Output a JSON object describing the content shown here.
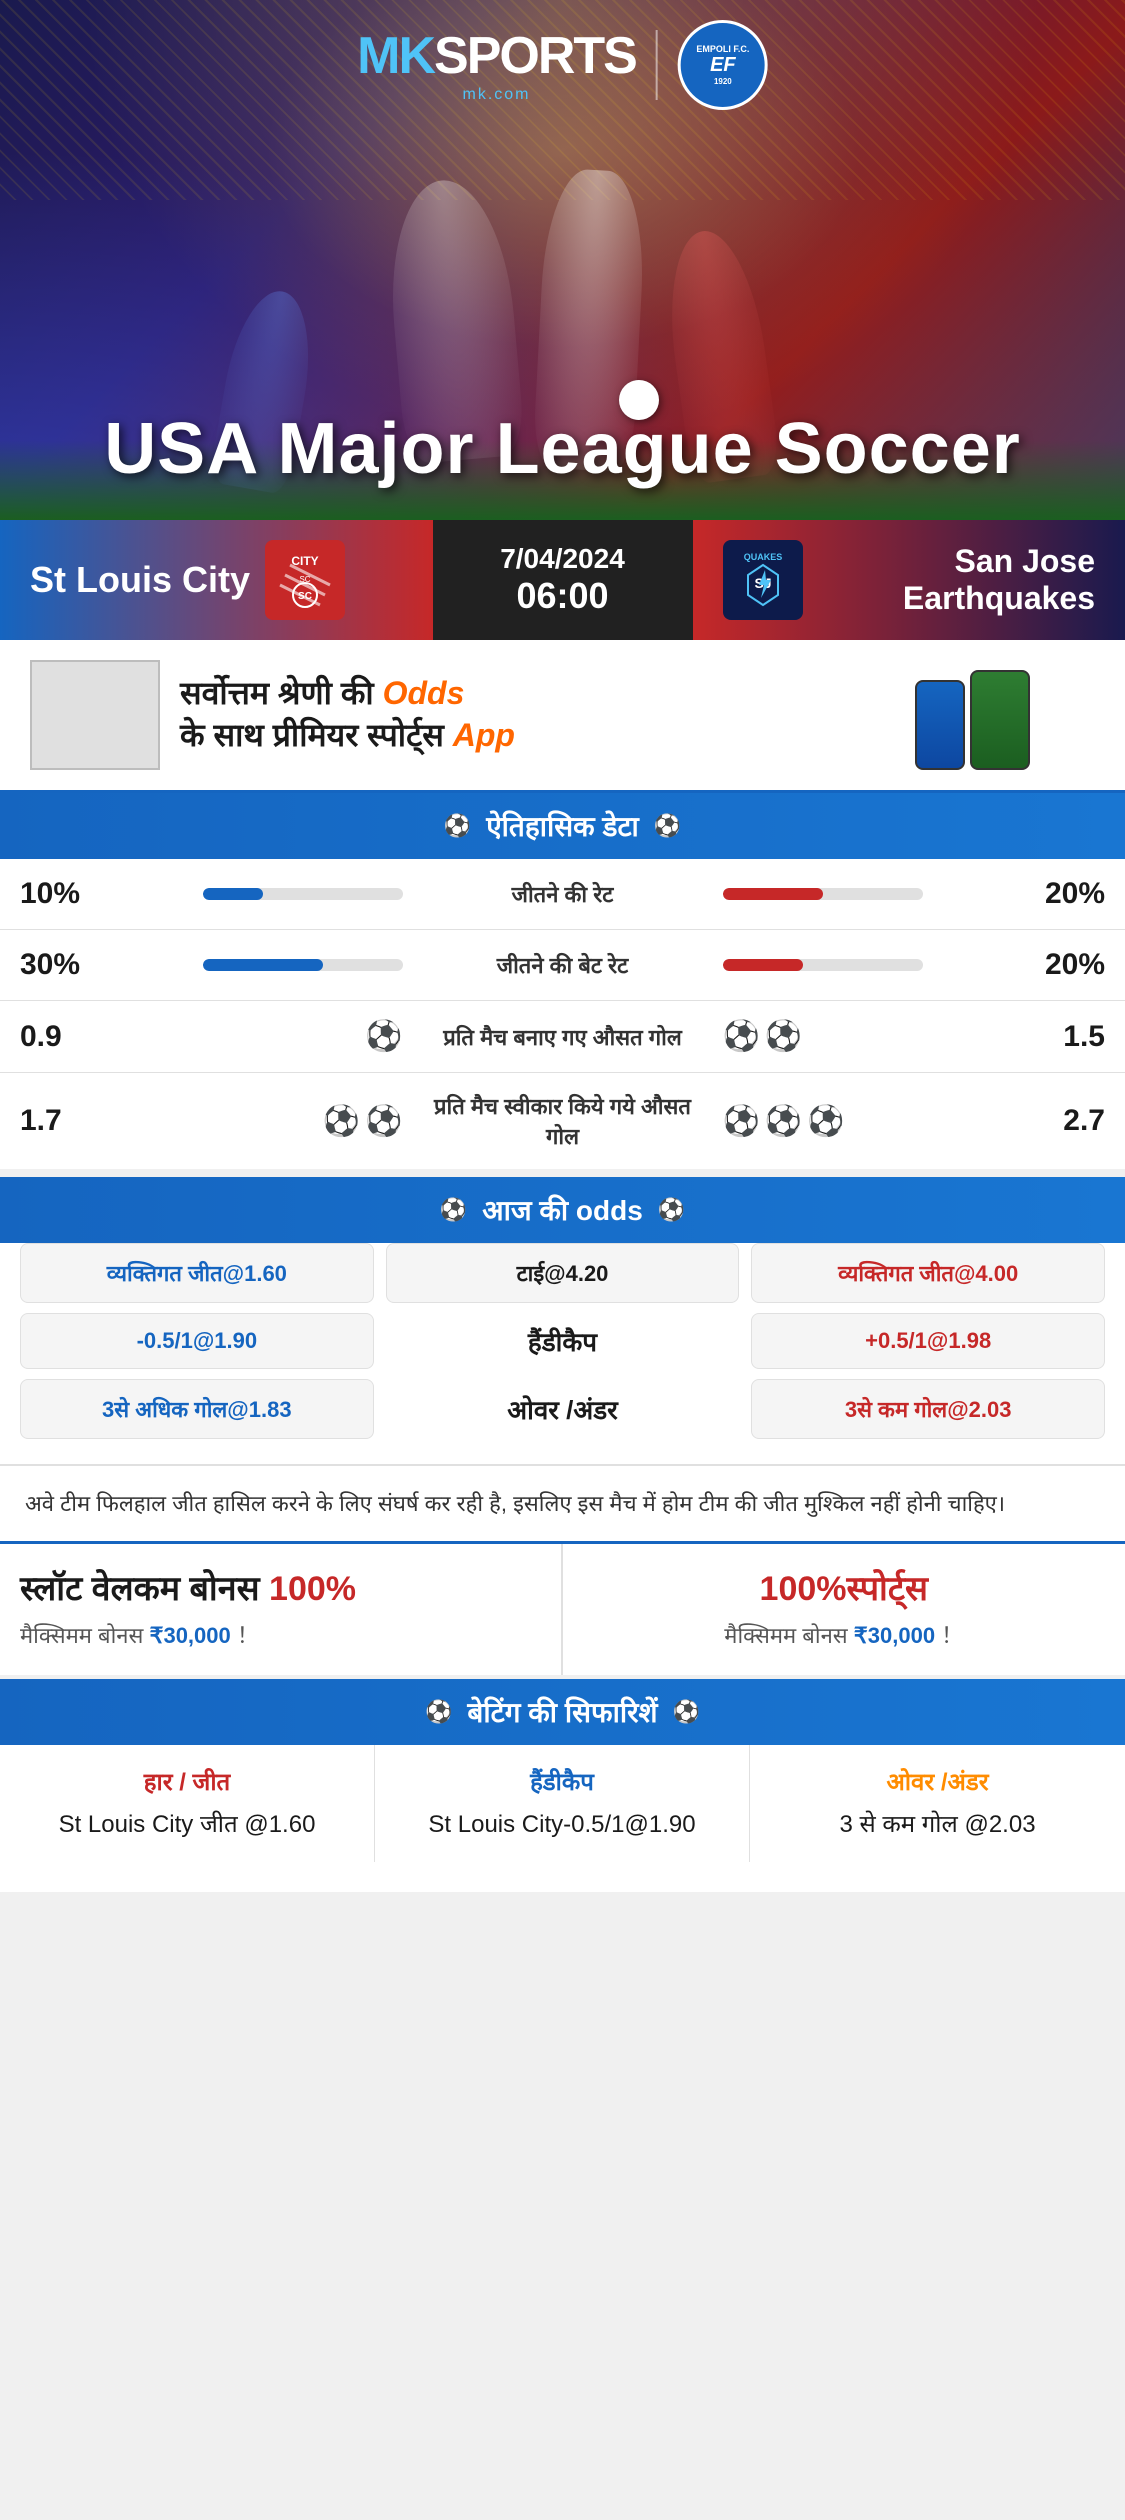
{
  "brand": {
    "name": "MK",
    "sports": "SPORTS",
    "domain": "mk.com",
    "partner": "EMPOLI F.C.",
    "partner_year": "1920"
  },
  "hero": {
    "league": "USA Major League Soccer"
  },
  "match": {
    "date": "7/04/2024",
    "time": "06:00",
    "home_team": "St Louis City",
    "away_team": "San Jose Earthquakes",
    "away_short": "QUAKES"
  },
  "ad": {
    "text": "सर्वोत्तम श्रेणी की",
    "highlight": "Odds",
    "text2": "के साथ प्रीमियर स्पोर्ट्स",
    "highlight2": "App"
  },
  "historical": {
    "section_title": "ऐतिहासिक डेटा",
    "rows": [
      {
        "label": "जीतने की रेट",
        "left_val": "10%",
        "right_val": "20%",
        "left_pct": 10,
        "right_pct": 20
      },
      {
        "label": "जीतने की बेट रेट",
        "left_val": "30%",
        "right_val": "20%",
        "left_pct": 30,
        "right_pct": 20
      },
      {
        "label": "प्रति मैच बनाए गए औसत गोल",
        "left_val": "0.9",
        "right_val": "1.5",
        "left_icons": 1,
        "right_icons": 2
      },
      {
        "label": "प्रति मैच स्वीकार किये गये औसत गोल",
        "left_val": "1.7",
        "right_val": "2.7",
        "left_icons": 2,
        "right_icons": 3
      }
    ]
  },
  "odds": {
    "section_title": "आज की odds",
    "home_win_label": "व्यक्तिगत जीत@1.60",
    "tie_label": "टाई@4.20",
    "away_win_label": "व्यक्तिगत जीत@4.00",
    "handicap_home": "-0.5/1@1.90",
    "handicap_label": "हैंडीकैप",
    "handicap_away": "+0.5/1@1.98",
    "over_home": "3से अधिक गोल@1.83",
    "over_label": "ओवर /अंडर",
    "under_away": "3से कम गोल@2.03"
  },
  "note": {
    "text": "अवे टीम फिलहाल जीत हासिल करने के लिए संघर्ष कर रही है, इसलिए इस मैच में होम टीम की जीत मुश्किल नहीं होनी चाहिए।"
  },
  "bonus": {
    "left_title": "स्लॉट वेलकम बोनस",
    "left_pct": "100%",
    "left_sub": "मैक्सिमम बोनस ₹30,000  ！",
    "right_title": "100%स्पोर्ट्स",
    "right_sub": "मैक्सिमम बोनस  ₹30,000 ！"
  },
  "recommendations": {
    "section_title": "बेटिंग की सिफारिशें",
    "items": [
      {
        "type": "हार / जीत",
        "value": "St Louis City जीत @1.60",
        "type_color": "win"
      },
      {
        "type": "हैंडीकैप",
        "value": "St Louis City-0.5/1@1.90",
        "type_color": "handicap"
      },
      {
        "type": "ओवर /अंडर",
        "value": "3 से कम गोल @2.03",
        "type_color": "ou"
      }
    ]
  }
}
